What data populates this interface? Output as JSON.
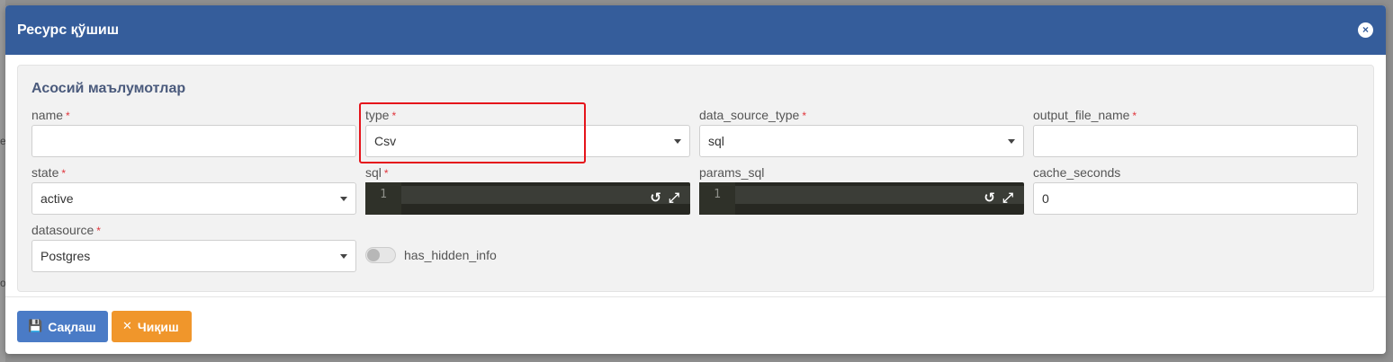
{
  "modal": {
    "title": "Ресурс қўшиш",
    "close_icon": "×"
  },
  "panel": {
    "title": "Асосий маълумотлар"
  },
  "fields": {
    "name": {
      "label": "name",
      "required": "*",
      "value": ""
    },
    "type": {
      "label": "type",
      "required": "*",
      "value": "Csv"
    },
    "data_source_type": {
      "label": "data_source_type",
      "required": "*",
      "value": "sql"
    },
    "output_file_name": {
      "label": "output_file_name",
      "required": "*",
      "value": ""
    },
    "state": {
      "label": "state",
      "required": "*",
      "value": "active"
    },
    "sql": {
      "label": "sql",
      "required": "*",
      "line_number": "1"
    },
    "params_sql": {
      "label": "params_sql",
      "line_number": "1"
    },
    "cache_seconds": {
      "label": "cache_seconds",
      "value": "0"
    },
    "datasource": {
      "label": "datasource",
      "required": "*",
      "value": "Postgres"
    },
    "has_hidden_info": {
      "label": "has_hidden_info",
      "enabled": false
    }
  },
  "editor_icons": {
    "undo": "↺",
    "fullscreen": "⤢"
  },
  "footer": {
    "save_label": "Сақлаш",
    "save_icon": "floppy-disk-icon",
    "exit_label": "Чиқиш",
    "exit_icon": "times-icon"
  },
  "colors": {
    "header": "#355d9b",
    "save_button": "#4a7bc6",
    "exit_button": "#f0962b",
    "highlight": "#e5141b",
    "required": "#e0343b"
  }
}
